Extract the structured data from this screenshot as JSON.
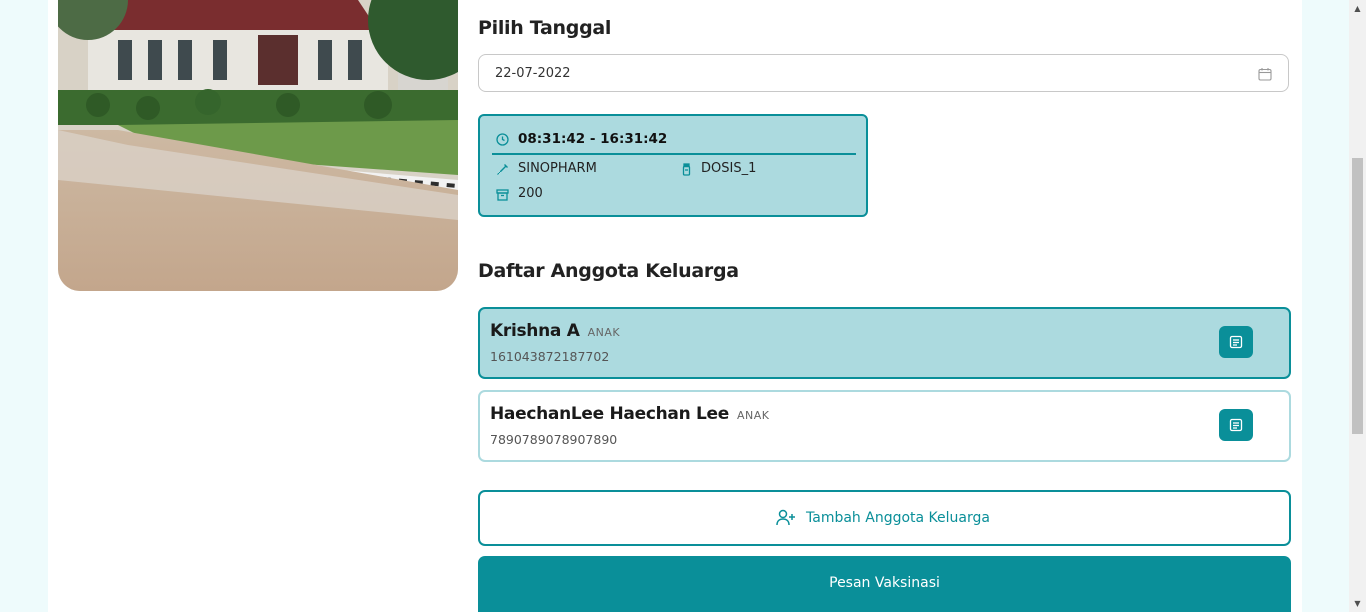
{
  "date_section": {
    "title": "Pilih Tanggal",
    "date_value": "22-07-2022"
  },
  "slot": {
    "time": "08:31:42 - 16:31:42",
    "vaccine": "SINOPHARM",
    "dose": "DOSIS_1",
    "quota": "200"
  },
  "family_section": {
    "title": "Daftar Anggota Keluarga",
    "members": [
      {
        "name": "Krishna A",
        "role": "ANAK",
        "nik": "161043872187702"
      },
      {
        "name": "HaechanLee Haechan Lee",
        "role": "ANAK",
        "nik": "7890789078907890"
      }
    ]
  },
  "actions": {
    "add_member": "Tambah Anggota Keluarga",
    "order": "Pesan Vaksinasi"
  },
  "colors": {
    "accent": "#0a8f99",
    "accent_light": "#acdadf"
  },
  "icons": {
    "calendar": "calendar-icon",
    "clock": "clock-icon",
    "syringe": "syringe-icon",
    "vial": "vial-icon",
    "box": "box-icon",
    "document": "document-icon",
    "add_user": "user-plus-icon"
  }
}
